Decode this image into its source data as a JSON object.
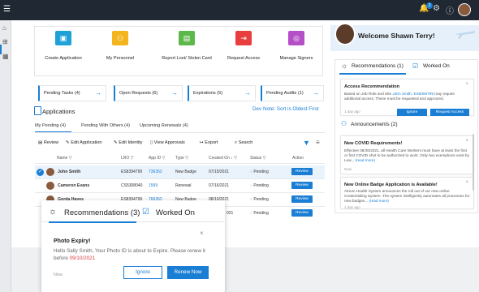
{
  "topbar": {
    "notifications": "3"
  },
  "tiles": [
    {
      "label": "Create Application",
      "color": "#1ea1d6",
      "icon": "document-plus-icon"
    },
    {
      "label": "My Personnel",
      "color": "#f3b41e",
      "icon": "people-icon"
    },
    {
      "label": "Report Lost/ Stolen Card",
      "color": "#5cb84a",
      "icon": "card-icon"
    },
    {
      "label": "Request Access",
      "color": "#e83e3e",
      "icon": "door-icon"
    },
    {
      "label": "Manage Signers",
      "color": "#b44fc8",
      "icon": "signer-icon"
    }
  ],
  "pending": [
    {
      "label": "Pending Tasks (4)"
    },
    {
      "label": "Open Requests (6)"
    },
    {
      "label": "Expirations (5)"
    },
    {
      "label": "Pending Audits (1)"
    }
  ],
  "applications": {
    "title": "Applications",
    "dev_note": "Dev Note: Sort is Oldest First",
    "tabs": [
      "My Pending (4)",
      "Pending With Others (4)",
      "Upcoming Renewals (4)"
    ],
    "toolbar": [
      "Review",
      "Edit Application",
      "Edit Identity",
      "View Approvals",
      "Export",
      "Search"
    ],
    "columns": [
      "Name",
      "LRO",
      "App ID",
      "Type",
      "Created On",
      "Status",
      "Action"
    ],
    "rows": [
      {
        "name": "John Smith",
        "lro": "ES8394799",
        "app_id": "736352",
        "type": "New Badge",
        "created": "07/15/2021",
        "status": "Pending",
        "action": "Review"
      },
      {
        "name": "Cameron Evans",
        "lro": "CS5308040",
        "app_id": "1599",
        "type": "Renewal",
        "created": "07/16/2021",
        "status": "Pending",
        "action": "Review"
      },
      {
        "name": "Gorda Hayes",
        "lro": "ES8394799",
        "app_id": "766352",
        "type": "New Badge",
        "created": "08/10/2021",
        "status": "Pending",
        "action": "Review"
      },
      {
        "name": "",
        "lro": "",
        "app_id": "",
        "type": "",
        "created": "021",
        "status": "Pending",
        "action": "Review"
      }
    ]
  },
  "popup": {
    "tab1": "Recommendations (3)",
    "tab2": "Worked On",
    "heading": "Photo Expiry!",
    "message_pre": "Hello Sally Smith, Your Photo ID is about to Expire. Please renew it before ",
    "message_date": "09/10/2021",
    "time": "Now",
    "ignore": "Ignore",
    "renew": "Renew Now"
  },
  "welcome": {
    "text": "Welcome Shawn Terry!"
  },
  "right_panel": {
    "tab1": "Recommendations (1)",
    "tab2": "Worked On",
    "access": {
      "title": "Access Recommendation",
      "body_pre": "Based on Job Role and Site ",
      "body_link": "John Smith, ES8394799",
      "body_post": " may require additional access. These must be requested and approved.",
      "time": "1 day ago",
      "ignore": "Ignore",
      "request": "Request Access"
    },
    "announcements_title": "Announcements (2)",
    "announcements": [
      {
        "title": "New COVID Requirements!",
        "body": "Effective 08/30/2021, all Health Care Workers must have at least the first or first COVID shot to be authorized to work. Only two exemptions exist by Low... ",
        "link": "(read more)",
        "time": "Now"
      },
      {
        "title": "New Online Badge Application is Available!",
        "body": "Atrium Health System announces the roll out of our new online Credentialing System. The system intelligently automates all processes for new badges... ",
        "link": "(read more)",
        "time": "1 day ago"
      }
    ]
  }
}
